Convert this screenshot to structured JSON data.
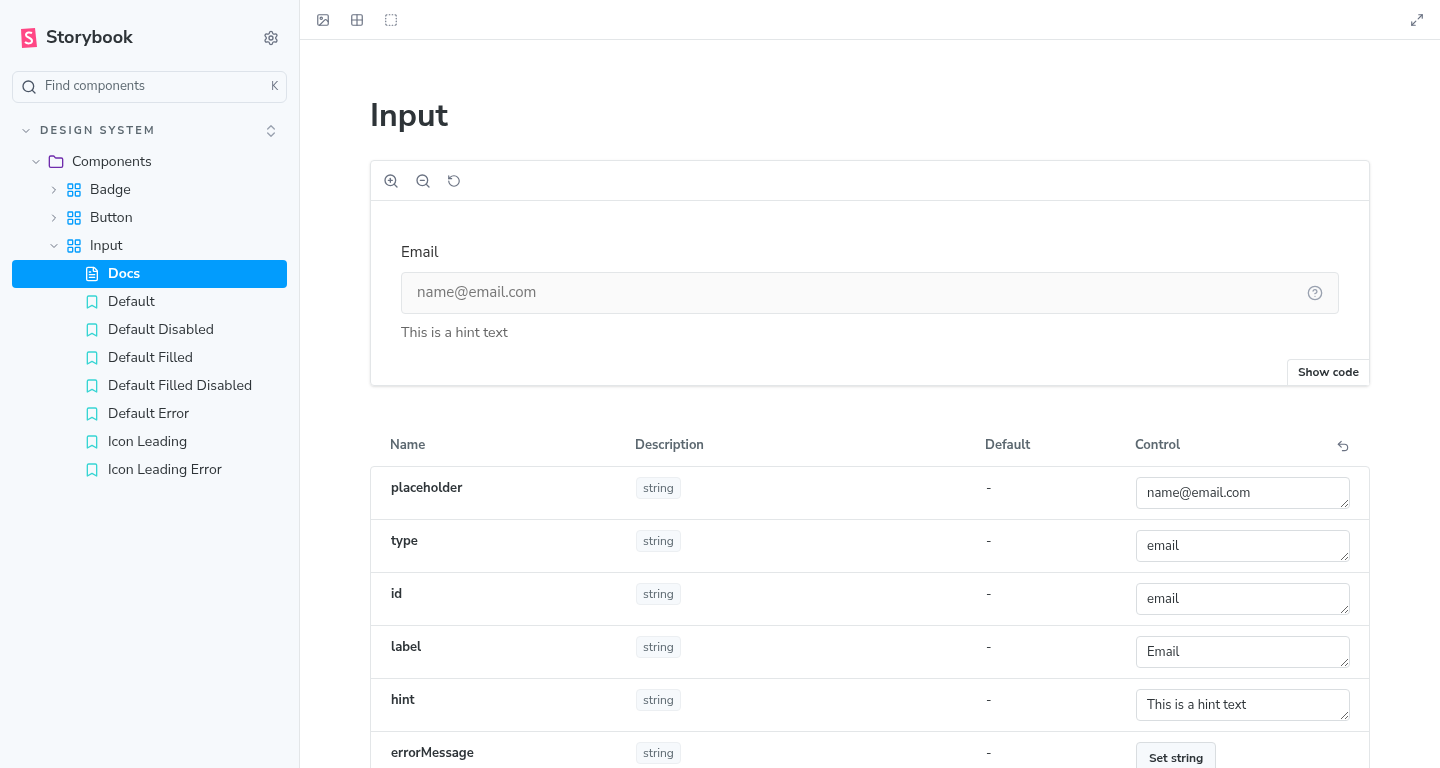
{
  "sidebar": {
    "brand": "Storybook",
    "search": {
      "placeholder": "Find components",
      "shortcut": "K"
    },
    "section": {
      "label": "DESIGN SYSTEM",
      "expanded": true,
      "children": [
        {
          "label": "Components",
          "kind": "folder",
          "expanded": true,
          "children": [
            {
              "label": "Badge",
              "kind": "component",
              "expanded": false
            },
            {
              "label": "Button",
              "kind": "component",
              "expanded": false
            },
            {
              "label": "Input",
              "kind": "component",
              "expanded": true,
              "children": [
                {
                  "label": "Docs",
                  "kind": "docs",
                  "selected": true
                },
                {
                  "label": "Default",
                  "kind": "story",
                  "selected": false
                },
                {
                  "label": "Default Disabled",
                  "kind": "story",
                  "selected": false
                },
                {
                  "label": "Default Filled",
                  "kind": "story",
                  "selected": false
                },
                {
                  "label": "Default Filled Disabled",
                  "kind": "story",
                  "selected": false
                },
                {
                  "label": "Default Error",
                  "kind": "story",
                  "selected": false
                },
                {
                  "label": "Icon Leading",
                  "kind": "story",
                  "selected": false
                },
                {
                  "label": "Icon Leading Error",
                  "kind": "story",
                  "selected": false
                }
              ]
            }
          ]
        }
      ]
    }
  },
  "page": {
    "title": "Input",
    "preview": {
      "label": "Email",
      "placeholder": "name@email.com",
      "hint": "This is a hint text",
      "show_code": "Show code"
    },
    "table": {
      "columns": [
        "Name",
        "Description",
        "Default",
        "Control"
      ],
      "rows": [
        {
          "name": "placeholder",
          "type": "string",
          "default": "-",
          "control": {
            "kind": "text",
            "value": "name@email.com"
          }
        },
        {
          "name": "type",
          "type": "string",
          "default": "-",
          "control": {
            "kind": "text",
            "value": "email"
          }
        },
        {
          "name": "id",
          "type": "string",
          "default": "-",
          "control": {
            "kind": "text",
            "value": "email"
          }
        },
        {
          "name": "label",
          "type": "string",
          "default": "-",
          "control": {
            "kind": "text",
            "value": "Email"
          }
        },
        {
          "name": "hint",
          "type": "string",
          "default": "-",
          "control": {
            "kind": "text",
            "value": "This is a hint text"
          }
        },
        {
          "name": "errorMessage",
          "type": "string",
          "default": "-",
          "control": {
            "kind": "button",
            "label": "Set string"
          }
        }
      ]
    }
  }
}
